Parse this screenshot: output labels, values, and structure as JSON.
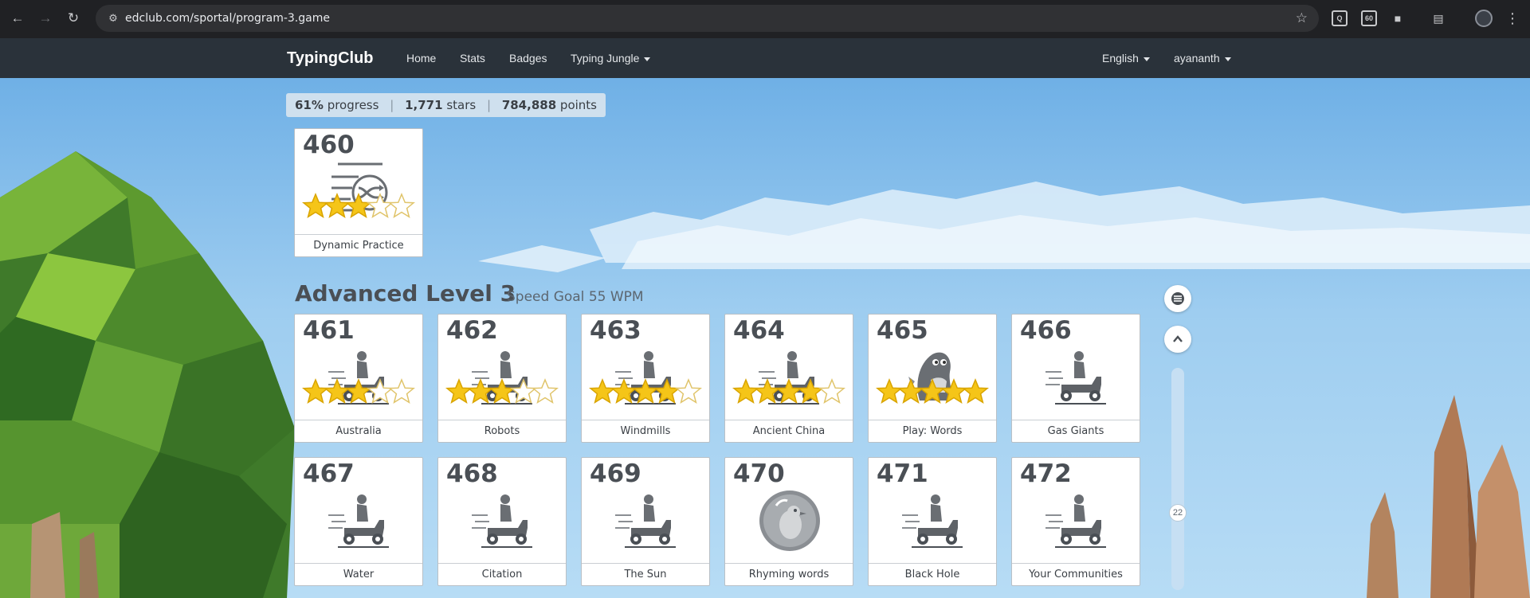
{
  "browser": {
    "url": "edclub.com/sportal/program-3.game",
    "icons": [
      "back-arrow-icon",
      "forward-arrow-icon",
      "reload-icon",
      "site-settings-icon",
      "bookmark-star-icon",
      "screenshot-search-icon",
      "extension-icon",
      "puzzle-icon",
      "reading-list-icon",
      "profile-avatar",
      "kebab-menu-icon"
    ]
  },
  "nav": {
    "brand": "TypingClub",
    "home": "Home",
    "stats": "Stats",
    "badges": "Badges",
    "jungle": "Typing Jungle",
    "language": "English",
    "user": "ayananth"
  },
  "progress": {
    "percent": "61%",
    "percent_label": "progress",
    "stars": "1,771",
    "stars_label": "stars",
    "points": "784,888",
    "points_label": "points"
  },
  "featured": {
    "number": "460",
    "name": "Dynamic Practice",
    "icon": "shuffle-lines-icon",
    "stars_earned": 3,
    "stars_total": 5
  },
  "level": {
    "title": "Advanced Level 3",
    "goal": "Speed Goal 55 WPM"
  },
  "lessons": [
    {
      "number": "461",
      "name": "Australia",
      "icon": "scooter-rider-icon",
      "stars_earned": 3,
      "stars_total": 5
    },
    {
      "number": "462",
      "name": "Robots",
      "icon": "scooter-rider-icon",
      "stars_earned": 3,
      "stars_total": 5
    },
    {
      "number": "463",
      "name": "Windmills",
      "icon": "scooter-rider-icon",
      "stars_earned": 4,
      "stars_total": 5
    },
    {
      "number": "464",
      "name": "Ancient China",
      "icon": "scooter-rider-icon",
      "stars_earned": 4,
      "stars_total": 5
    },
    {
      "number": "465",
      "name": "Play: Words",
      "icon": "dinosaur-icon",
      "stars_earned": 5,
      "stars_total": 5
    },
    {
      "number": "466",
      "name": "Gas Giants",
      "icon": "scooter-rider-icon",
      "stars_earned": 0,
      "stars_total": 0
    },
    {
      "number": "467",
      "name": "Water",
      "icon": "scooter-rider-icon",
      "stars_earned": 0,
      "stars_total": 0
    },
    {
      "number": "468",
      "name": "Citation",
      "icon": "scooter-rider-icon",
      "stars_earned": 0,
      "stars_total": 0
    },
    {
      "number": "469",
      "name": "The Sun",
      "icon": "scooter-rider-icon",
      "stars_earned": 0,
      "stars_total": 0
    },
    {
      "number": "470",
      "name": "Rhyming words",
      "icon": "bird-bubble-icon",
      "stars_earned": 0,
      "stars_total": 0
    },
    {
      "number": "471",
      "name": "Black Hole",
      "icon": "scooter-rider-icon",
      "stars_earned": 0,
      "stars_total": 0
    },
    {
      "number": "472",
      "name": "Your Communities",
      "icon": "scooter-rider-icon",
      "stars_earned": 0,
      "stars_total": 0
    }
  ],
  "controls": {
    "menu_icon": "list-menu-icon",
    "up_icon": "chevron-up-icon",
    "scroll_indicator": "22"
  },
  "colors": {
    "navbar": "#2a323a",
    "browser_bar": "#202124",
    "star_fill": "#f5c518",
    "card_text": "#4a4f55"
  }
}
